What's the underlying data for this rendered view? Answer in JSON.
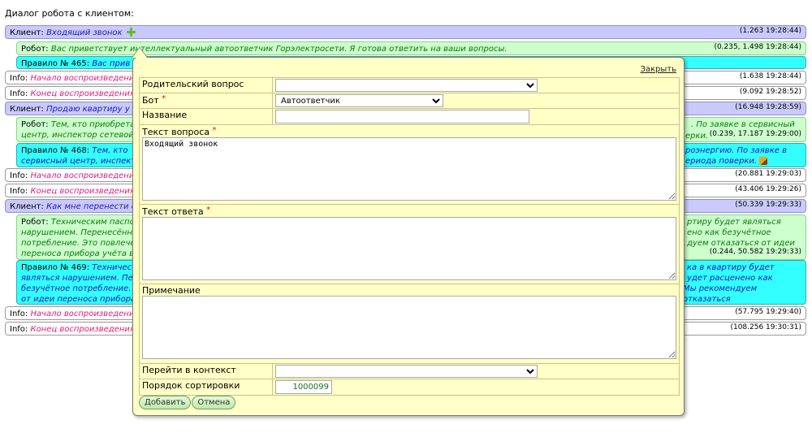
{
  "page": {
    "title": "Диалог робота с клиентом:"
  },
  "rows": [
    {
      "who": "Клиент:",
      "text": "Входящий звонок",
      "ts": "(1.263 19:28:44)"
    },
    {
      "who": "Робот:",
      "text": "Вас приветствует интеллектуальный автоответчик Горэлектросети. Я готова ответить на ваши вопросы.",
      "ts": "(0.235, 1.498 19:28:44)"
    },
    {
      "who": "Правило № 465:",
      "text": "Вас прив"
    },
    {
      "who": "Info:",
      "text": "Начало воспроизведени",
      "ts": "(1.638 19:28:44)"
    },
    {
      "who": "Info:",
      "text": "Конец воспроизведения",
      "ts": "(9.092 19:28:52)"
    },
    {
      "who": "Клиент:",
      "text": "Продаю квартиру у м",
      "ts": "(16.948 19:28:59)"
    },
    {
      "who": "Робот:",
      "text_a": "Тем, кто приобрета",
      "text_b": "центр, инспектор сетевой",
      "right_a": ". По заявке в сервисный",
      "right_b": "ерки.",
      "ts": "(0.239, 17.187 19:29:00)"
    },
    {
      "who": "Правило № 468:",
      "text_a": "Тем, кто",
      "text_b": "сервисный центр, инспект",
      "right_a": "роэнергию. По заявке в",
      "right_b": "ериода поверки."
    },
    {
      "who": "Info:",
      "text": "Начало воспроизведени",
      "ts": "(20.881 19:29:03)"
    },
    {
      "who": "Info:",
      "text": "Конец воспроизведения",
      "ts": "(43.406 19:29:26)"
    },
    {
      "who": "Клиент:",
      "text": "Как мне перенести сч",
      "ts": "(50.339 19:29:33)"
    },
    {
      "who": "Робот:",
      "text_a": "Техническим паспор",
      "text_b": "нарушением. Перенесённы",
      "text_c": "потребление. Это повлечё",
      "text_d": "переноса прибора учёта во",
      "right_a": "ртиру будет являться",
      "right_b": "ено как безучётное",
      "right_c": "дуем отказаться от идеи",
      "ts": "(0.244, 50.582 19:29:33)"
    },
    {
      "who": "Правило № 469:",
      "text_a": "Техничес",
      "text_b": "являться нарушением. Пер",
      "text_c": "безучётное потребление. Э",
      "text_d": "от идеи переноса прибора",
      "right_a": "ка в квартиру будет",
      "right_b": "удет расценено как",
      "right_c": "Мы рекомендуем отказаться"
    },
    {
      "who": "Info:",
      "text": "Начало воспроизведени",
      "ts": "(57.795 19:29:40)"
    },
    {
      "who": "Info:",
      "text": "Конец воспроизведения",
      "ts": "(108.256 19:30:31)"
    }
  ],
  "dialog": {
    "close_label": "Закрыть",
    "fields": {
      "parent_label": "Родительский вопрос",
      "parent_value": "",
      "bot_label": "Бот",
      "bot_value": "Автоответчик",
      "name_label": "Название",
      "name_value": "",
      "question_label": "Текст вопроса",
      "question_value": "Входящий звонок",
      "answer_label": "Текст ответа",
      "answer_value": "",
      "note_label": "Примечание",
      "note_value": "",
      "context_label": "Перейти в контекст",
      "context_value": "",
      "sort_label": "Порядок сортировки",
      "sort_value": "1000099"
    },
    "required_mark": "*",
    "buttons": {
      "add": "Добавить",
      "cancel": "Отмена"
    }
  }
}
